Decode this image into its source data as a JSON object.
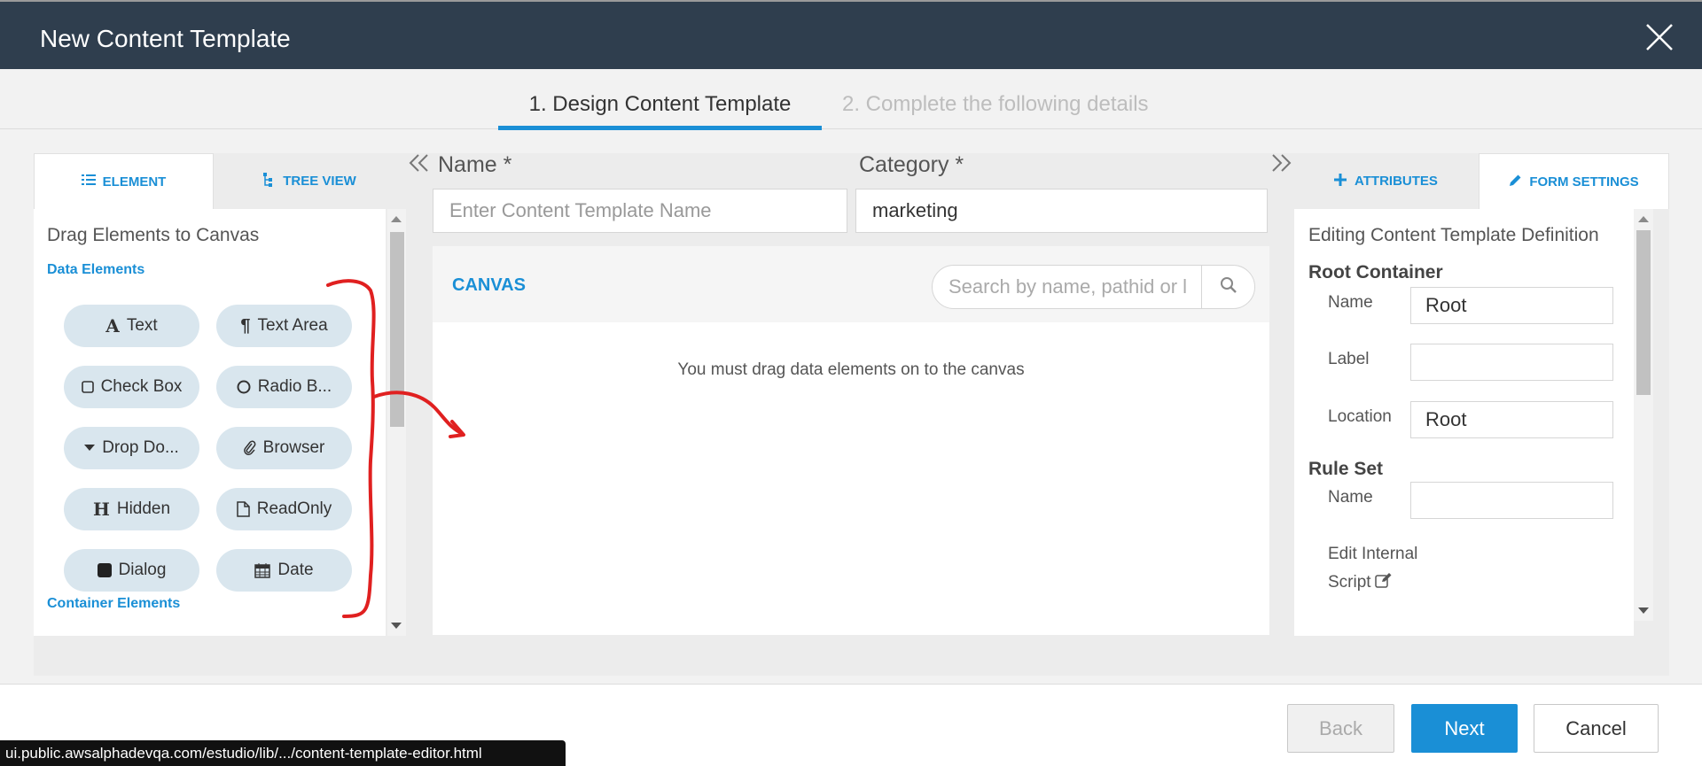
{
  "dialog": {
    "title": "New Content Template"
  },
  "steps": [
    {
      "label": "1. Design Content Template"
    },
    {
      "label": "2. Complete the following details"
    }
  ],
  "left_panel": {
    "tabs": [
      {
        "label": "ELEMENT",
        "icon": "list-icon"
      },
      {
        "label": "TREE VIEW",
        "icon": "tree-icon"
      }
    ],
    "hint": "Drag Elements to Canvas",
    "data_group": "Data Elements",
    "container_group": "Container Elements",
    "elements": [
      {
        "label": "Text",
        "icon": "text-icon"
      },
      {
        "label": "Text Area",
        "icon": "paragraph-icon"
      },
      {
        "label": "Check Box",
        "icon": "checkbox-icon"
      },
      {
        "label": "Radio B...",
        "icon": "radio-icon"
      },
      {
        "label": "Drop Do...",
        "icon": "caret-down-icon"
      },
      {
        "label": "Browser",
        "icon": "paperclip-icon"
      },
      {
        "label": "Hidden",
        "icon": "hidden-icon"
      },
      {
        "label": "ReadOnly",
        "icon": "file-icon"
      },
      {
        "label": "Dialog",
        "icon": "square-icon"
      },
      {
        "label": "Date",
        "icon": "calendar-icon"
      }
    ]
  },
  "form": {
    "name_label": "Name *",
    "name_placeholder": "Enter Content Template Name",
    "category_label": "Category *",
    "category_value": "marketing"
  },
  "canvas": {
    "title": "CANVAS",
    "search_placeholder": "Search by name, pathid or l",
    "empty_message": "You must drag data elements on to the canvas"
  },
  "right_panel": {
    "tabs": [
      {
        "label": "ATTRIBUTES",
        "icon": "plus-icon"
      },
      {
        "label": "FORM SETTINGS",
        "icon": "pencil-icon"
      }
    ],
    "heading": "Editing Content Template Definition",
    "root_container": {
      "title": "Root Container",
      "name_label": "Name",
      "name_value": "Root",
      "label_label": "Label",
      "label_value": "",
      "location_label": "Location",
      "location_value": "Root"
    },
    "rule_set": {
      "title": "Rule Set",
      "name_label": "Name",
      "name_value": "",
      "edit_script_line1": "Edit Internal",
      "edit_script_line2": "Script"
    }
  },
  "footer": {
    "back_label": "Back",
    "next_label": "Next",
    "cancel_label": "Cancel"
  },
  "status_bar": {
    "url": "ui.public.awsalphadevqa.com/estudio/lib/.../content-template-editor.html"
  },
  "colors": {
    "header_bg": "#2f3e4e",
    "accent": "#1a8fd6",
    "pill_bg": "#d9e6ee",
    "annotation": "#e02020"
  }
}
